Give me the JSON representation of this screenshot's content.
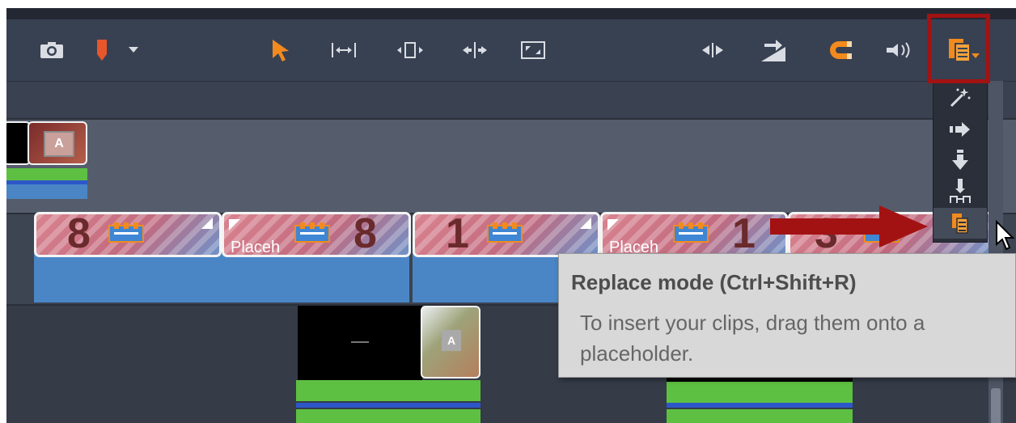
{
  "toolbar": {
    "left_tools": [
      {
        "icon": "camera-icon"
      },
      {
        "icon": "marker-icon"
      },
      {
        "icon": "dropdown-arrow-icon"
      }
    ],
    "center_tools": [
      {
        "icon": "pointer-arrow-icon"
      },
      {
        "icon": "ripple-trim-icon"
      },
      {
        "icon": "slip-trim-icon"
      },
      {
        "icon": "slide-trim-icon"
      },
      {
        "icon": "stretch-icon"
      }
    ],
    "right_tools": [
      {
        "icon": "split-icon"
      },
      {
        "icon": "insert-gap-icon"
      },
      {
        "icon": "magnet-icon"
      },
      {
        "icon": "audio-scrub-icon"
      },
      {
        "icon": "editing-mode-icon"
      }
    ],
    "accent_color": "#f28a1e"
  },
  "editing_mode_menu": {
    "items": [
      {
        "icon": "smart-mode-icon",
        "selected": false
      },
      {
        "icon": "insert-mode-icon",
        "selected": false
      },
      {
        "icon": "overwrite-mode-icon",
        "selected": false
      },
      {
        "icon": "pushed-mode-icon",
        "selected": false
      },
      {
        "icon": "replace-mode-icon",
        "selected": true
      }
    ]
  },
  "timeline": {
    "placeholders": [
      {
        "number": "8",
        "label": ""
      },
      {
        "number": "8",
        "label": "Placeh"
      },
      {
        "number": "1",
        "label": ""
      },
      {
        "number": "1",
        "label": "Placeh"
      },
      {
        "number": "3",
        "label": ""
      }
    ],
    "thumbnail_letter": "A"
  },
  "tooltip": {
    "title": "Replace mode (Ctrl+Shift+R)",
    "description": "To insert your clips, drag them onto a placeholder."
  },
  "annotation_color": "#a31212"
}
